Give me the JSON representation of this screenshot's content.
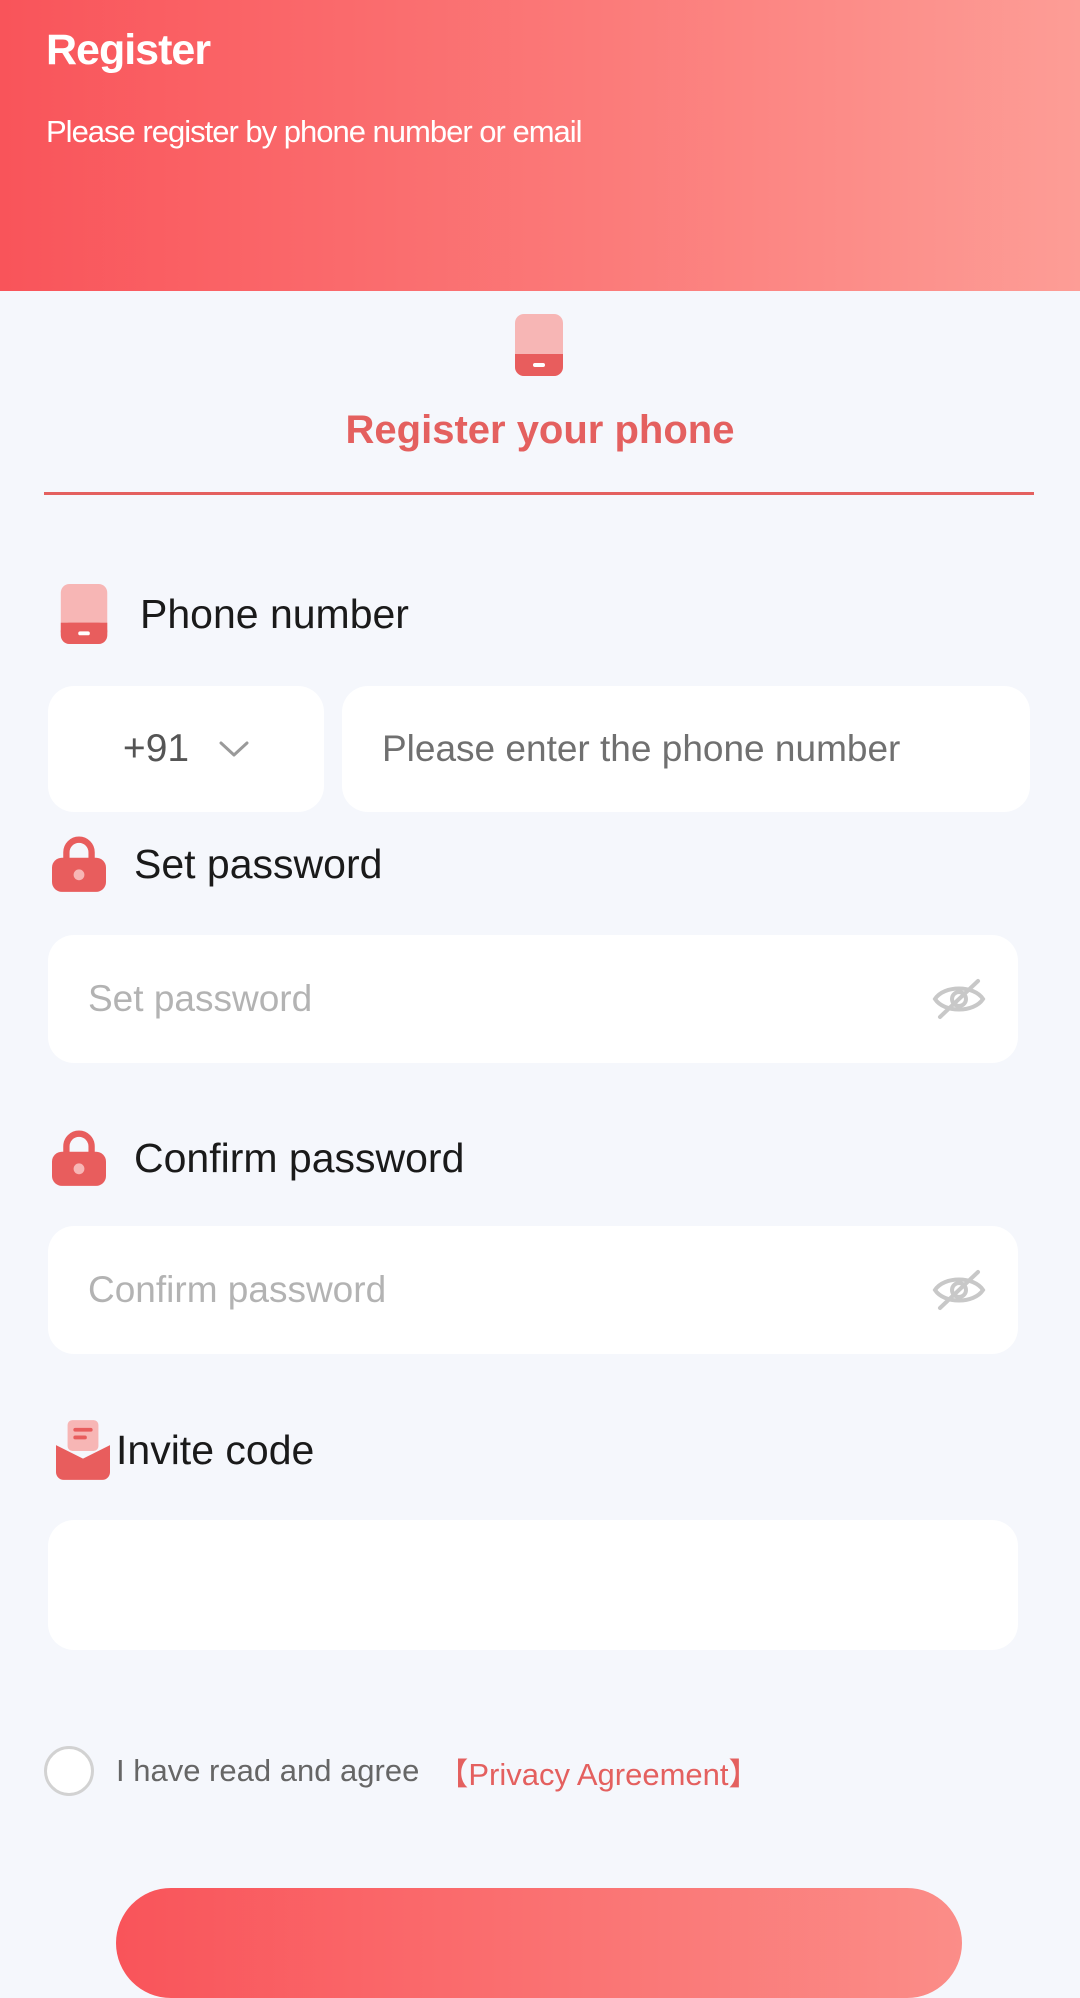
{
  "header": {
    "title": "Register",
    "subtitle": "Please register by phone number or email"
  },
  "tab": {
    "label": "Register your phone",
    "icon": "phone-icon"
  },
  "phone": {
    "label": "Phone number",
    "icon": "phone-icon",
    "country_code": "+91",
    "placeholder": "Please enter the phone number"
  },
  "password": {
    "label": "Set password",
    "icon": "lock-icon",
    "placeholder": "Set password",
    "toggle_icon": "eye-off-icon"
  },
  "confirm": {
    "label": "Confirm password",
    "icon": "lock-icon",
    "placeholder": "Confirm password",
    "toggle_icon": "eye-off-icon"
  },
  "invite": {
    "label": "Invite code",
    "icon": "invitation-icon",
    "placeholder": ""
  },
  "agreement": {
    "text": "I have read and agree",
    "link": "【Privacy Agreement】",
    "checked": false
  },
  "colors": {
    "accent": "#e4605f",
    "header_gradient_start": "#f9545a",
    "header_gradient_end": "#fd9d96",
    "background": "#f5f7fc"
  }
}
